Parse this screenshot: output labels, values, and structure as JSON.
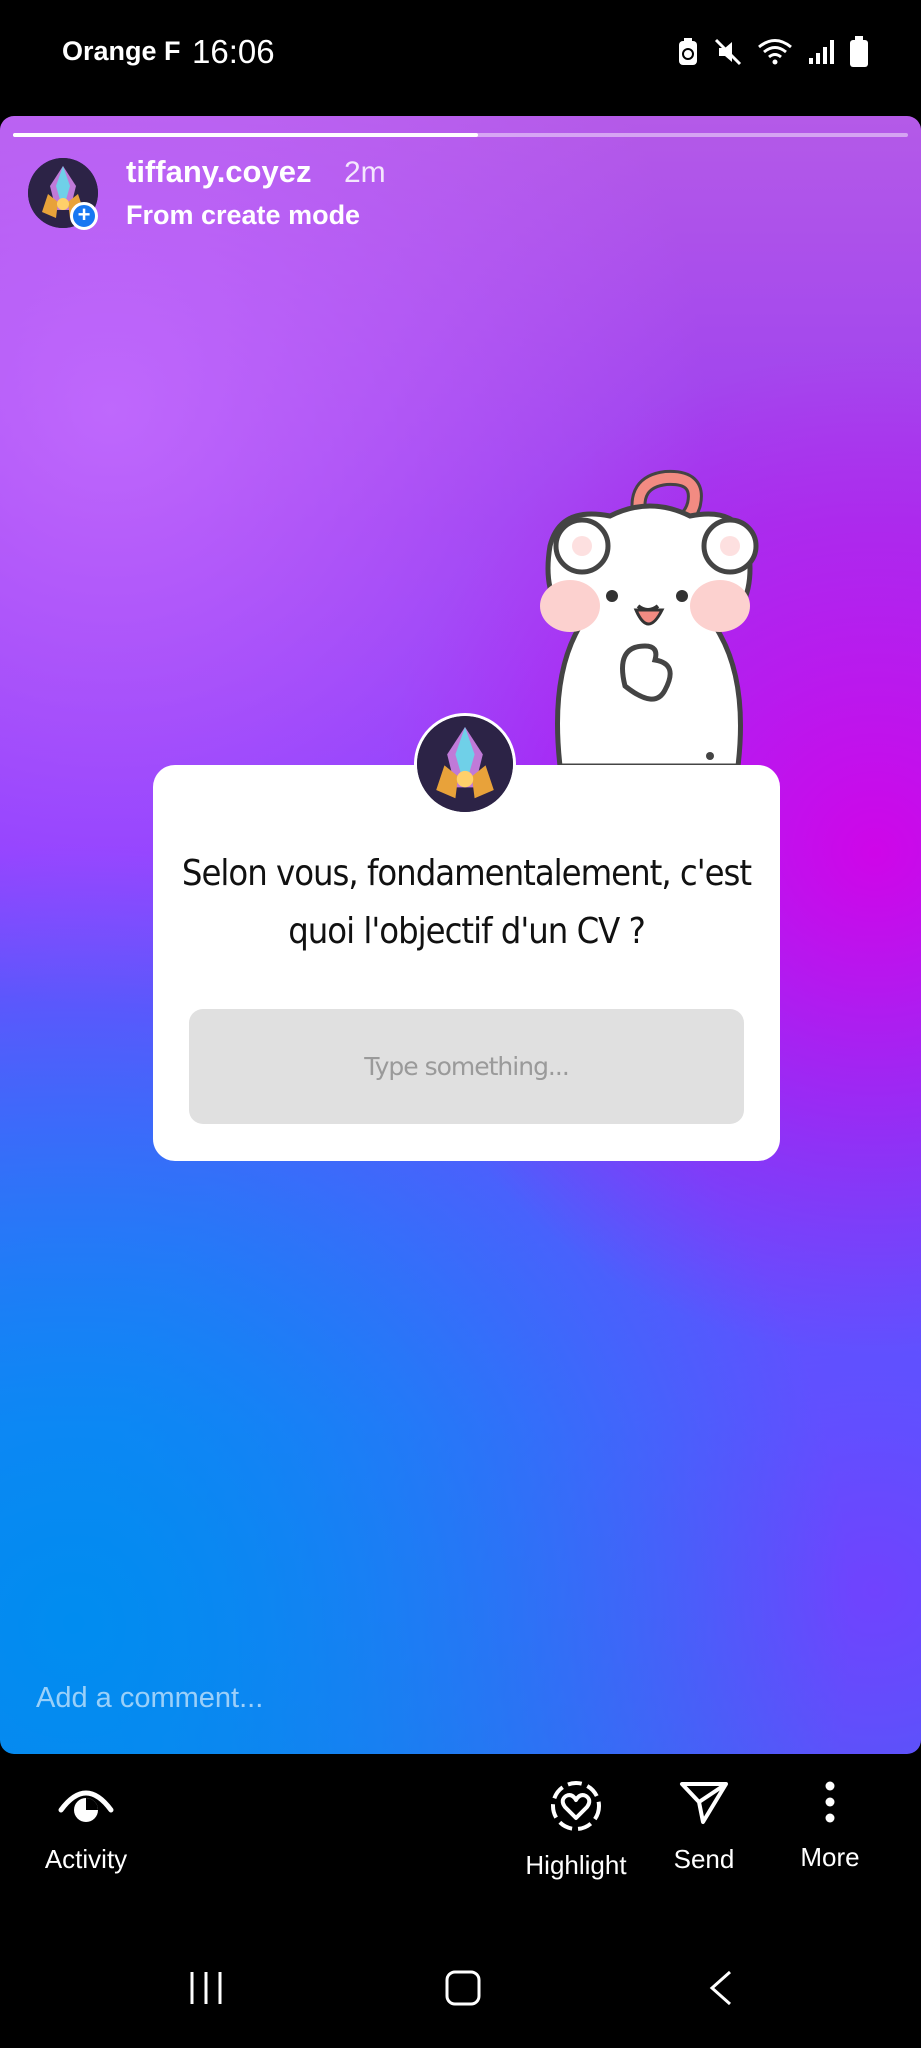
{
  "status_bar": {
    "carrier": "Orange F",
    "time": "16:06",
    "icons": [
      "battery-saver-icon",
      "mute-icon",
      "wifi-icon",
      "signal-icon",
      "battery-icon"
    ]
  },
  "story": {
    "progress": 0.52,
    "username": "tiffany.coyez",
    "time_ago": "2m",
    "subtitle": "From create mode"
  },
  "question_sticker": {
    "question": "Selon vous, fondamentalement, c'est quoi l'objectif d'un CV ?",
    "input_placeholder": "Type something..."
  },
  "comment": {
    "placeholder": "Add a comment..."
  },
  "actions": [
    {
      "label": "Activity",
      "icon": "activity-eye-icon"
    },
    {
      "label": "Highlight",
      "icon": "highlight-heart-icon"
    },
    {
      "label": "Send",
      "icon": "send-icon"
    },
    {
      "label": "More",
      "icon": "more-vertical-icon"
    }
  ],
  "colors": {
    "badge_blue": "#1877f2",
    "input_bg": "#e0e0e0"
  }
}
